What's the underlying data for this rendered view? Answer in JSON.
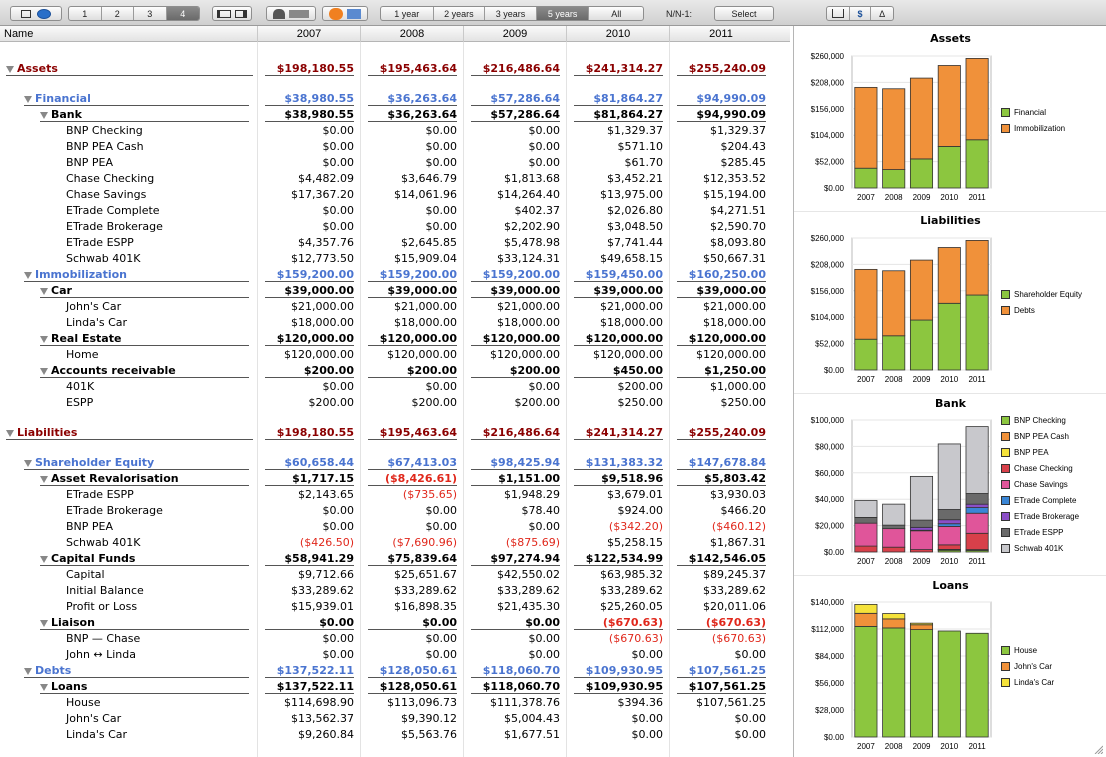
{
  "toolbar": {
    "levels": [
      "1",
      "2",
      "3",
      "4"
    ],
    "selected_level": "4",
    "periods": [
      "1 year",
      "2 years",
      "3 years",
      "5 years",
      "All"
    ],
    "selected_period": "5 years",
    "nn_label": "N/N-1:",
    "select_label": "Select",
    "currency_symbol": "$",
    "delta_symbol": "Δ"
  },
  "table": {
    "name_header": "Name",
    "years": [
      "2007",
      "2008",
      "2009",
      "2010",
      "2011"
    ],
    "rows": [
      {
        "name": "Assets",
        "level": 0,
        "kind": "red",
        "tri": true,
        "v": [
          "$198,180.55",
          "$195,463.64",
          "$216,486.64",
          "$241,314.27",
          "$255,240.09"
        ]
      },
      {
        "name": "",
        "level": 0,
        "kind": "blank",
        "v": [
          "",
          "",
          "",
          "",
          ""
        ]
      },
      {
        "name": "Financial",
        "level": 1,
        "kind": "blue",
        "tri": true,
        "v": [
          "$38,980.55",
          "$36,263.64",
          "$57,286.64",
          "$81,864.27",
          "$94,990.09"
        ]
      },
      {
        "name": "Bank",
        "level": 2,
        "kind": "bold",
        "tri": true,
        "v": [
          "$38,980.55",
          "$36,263.64",
          "$57,286.64",
          "$81,864.27",
          "$94,990.09"
        ]
      },
      {
        "name": "BNP Checking",
        "level": 3,
        "kind": "plain",
        "v": [
          "$0.00",
          "$0.00",
          "$0.00",
          "$1,329.37",
          "$1,329.37"
        ]
      },
      {
        "name": "BNP PEA Cash",
        "level": 3,
        "kind": "plain",
        "v": [
          "$0.00",
          "$0.00",
          "$0.00",
          "$571.10",
          "$204.43"
        ]
      },
      {
        "name": "BNP PEA",
        "level": 3,
        "kind": "plain",
        "v": [
          "$0.00",
          "$0.00",
          "$0.00",
          "$61.70",
          "$285.45"
        ]
      },
      {
        "name": "Chase Checking",
        "level": 3,
        "kind": "plain",
        "v": [
          "$4,482.09",
          "$3,646.79",
          "$1,813.68",
          "$3,452.21",
          "$12,353.52"
        ]
      },
      {
        "name": "Chase Savings",
        "level": 3,
        "kind": "plain",
        "v": [
          "$17,367.20",
          "$14,061.96",
          "$14,264.40",
          "$13,975.00",
          "$15,194.00"
        ]
      },
      {
        "name": "ETrade Complete",
        "level": 3,
        "kind": "plain",
        "v": [
          "$0.00",
          "$0.00",
          "$402.37",
          "$2,026.80",
          "$4,271.51"
        ]
      },
      {
        "name": "ETrade Brokerage",
        "level": 3,
        "kind": "plain",
        "v": [
          "$0.00",
          "$0.00",
          "$2,202.90",
          "$3,048.50",
          "$2,590.70"
        ]
      },
      {
        "name": "ETrade ESPP",
        "level": 3,
        "kind": "plain",
        "v": [
          "$4,357.76",
          "$2,645.85",
          "$5,478.98",
          "$7,741.44",
          "$8,093.80"
        ]
      },
      {
        "name": "Schwab 401K",
        "level": 3,
        "kind": "plain",
        "v": [
          "$12,773.50",
          "$15,909.04",
          "$33,124.31",
          "$49,658.15",
          "$50,667.31"
        ]
      },
      {
        "name": "Immobilization",
        "level": 1,
        "kind": "blue",
        "tri": true,
        "v": [
          "$159,200.00",
          "$159,200.00",
          "$159,200.00",
          "$159,450.00",
          "$160,250.00"
        ]
      },
      {
        "name": "Car",
        "level": 2,
        "kind": "bold",
        "tri": true,
        "v": [
          "$39,000.00",
          "$39,000.00",
          "$39,000.00",
          "$39,000.00",
          "$39,000.00"
        ]
      },
      {
        "name": "John's Car",
        "level": 3,
        "kind": "plain",
        "v": [
          "$21,000.00",
          "$21,000.00",
          "$21,000.00",
          "$21,000.00",
          "$21,000.00"
        ]
      },
      {
        "name": "Linda's Car",
        "level": 3,
        "kind": "plain",
        "v": [
          "$18,000.00",
          "$18,000.00",
          "$18,000.00",
          "$18,000.00",
          "$18,000.00"
        ]
      },
      {
        "name": "Real Estate",
        "level": 2,
        "kind": "bold",
        "tri": true,
        "v": [
          "$120,000.00",
          "$120,000.00",
          "$120,000.00",
          "$120,000.00",
          "$120,000.00"
        ]
      },
      {
        "name": "Home",
        "level": 3,
        "kind": "plain",
        "v": [
          "$120,000.00",
          "$120,000.00",
          "$120,000.00",
          "$120,000.00",
          "$120,000.00"
        ]
      },
      {
        "name": "Accounts receivable",
        "level": 2,
        "kind": "bold",
        "tri": true,
        "v": [
          "$200.00",
          "$200.00",
          "$200.00",
          "$450.00",
          "$1,250.00"
        ]
      },
      {
        "name": "401K",
        "level": 3,
        "kind": "plain",
        "v": [
          "$0.00",
          "$0.00",
          "$0.00",
          "$200.00",
          "$1,000.00"
        ]
      },
      {
        "name": "ESPP",
        "level": 3,
        "kind": "plain",
        "v": [
          "$200.00",
          "$200.00",
          "$200.00",
          "$250.00",
          "$250.00"
        ]
      },
      {
        "name": "",
        "level": 0,
        "kind": "blank",
        "v": [
          "",
          "",
          "",
          "",
          ""
        ]
      },
      {
        "name": "Liabilities",
        "level": 0,
        "kind": "red",
        "tri": true,
        "v": [
          "$198,180.55",
          "$195,463.64",
          "$216,486.64",
          "$241,314.27",
          "$255,240.09"
        ]
      },
      {
        "name": "",
        "level": 0,
        "kind": "blank",
        "v": [
          "",
          "",
          "",
          "",
          ""
        ]
      },
      {
        "name": "Shareholder Equity",
        "level": 1,
        "kind": "blue",
        "tri": true,
        "v": [
          "$60,658.44",
          "$67,413.03",
          "$98,425.94",
          "$131,383.32",
          "$147,678.84"
        ]
      },
      {
        "name": "Asset Revalorisation",
        "level": 2,
        "kind": "bold",
        "tri": true,
        "v": [
          "$1,717.15",
          "($8,426.61)",
          "$1,151.00",
          "$9,518.96",
          "$5,803.42"
        ]
      },
      {
        "name": "ETrade ESPP",
        "level": 3,
        "kind": "plain",
        "v": [
          "$2,143.65",
          "($735.65)",
          "$1,948.29",
          "$3,679.01",
          "$3,930.03"
        ]
      },
      {
        "name": "ETrade Brokerage",
        "level": 3,
        "kind": "plain",
        "v": [
          "$0.00",
          "$0.00",
          "$78.40",
          "$924.00",
          "$466.20"
        ]
      },
      {
        "name": "BNP PEA",
        "level": 3,
        "kind": "plain",
        "v": [
          "$0.00",
          "$0.00",
          "$0.00",
          "($342.20)",
          "($460.12)"
        ]
      },
      {
        "name": "Schwab 401K",
        "level": 3,
        "kind": "plain",
        "v": [
          "($426.50)",
          "($7,690.96)",
          "($875.69)",
          "$5,258.15",
          "$1,867.31"
        ]
      },
      {
        "name": "Capital Funds",
        "level": 2,
        "kind": "bold",
        "tri": true,
        "v": [
          "$58,941.29",
          "$75,839.64",
          "$97,274.94",
          "$122,534.99",
          "$142,546.05"
        ]
      },
      {
        "name": "Capital",
        "level": 3,
        "kind": "plain",
        "v": [
          "$9,712.66",
          "$25,651.67",
          "$42,550.02",
          "$63,985.32",
          "$89,245.37"
        ]
      },
      {
        "name": "Initial Balance",
        "level": 3,
        "kind": "plain",
        "v": [
          "$33,289.62",
          "$33,289.62",
          "$33,289.62",
          "$33,289.62",
          "$33,289.62"
        ]
      },
      {
        "name": "Profit or Loss",
        "level": 3,
        "kind": "plain",
        "v": [
          "$15,939.01",
          "$16,898.35",
          "$21,435.30",
          "$25,260.05",
          "$20,011.06"
        ]
      },
      {
        "name": "Liaison",
        "level": 2,
        "kind": "bold",
        "tri": true,
        "v": [
          "$0.00",
          "$0.00",
          "$0.00",
          "($670.63)",
          "($670.63)"
        ]
      },
      {
        "name": "BNP — Chase",
        "level": 3,
        "kind": "plain",
        "v": [
          "$0.00",
          "$0.00",
          "$0.00",
          "($670.63)",
          "($670.63)"
        ]
      },
      {
        "name": "John ↔ Linda",
        "level": 3,
        "kind": "plain",
        "v": [
          "$0.00",
          "$0.00",
          "$0.00",
          "$0.00",
          "$0.00"
        ]
      },
      {
        "name": "Debts",
        "level": 1,
        "kind": "blue",
        "tri": true,
        "v": [
          "$137,522.11",
          "$128,050.61",
          "$118,060.70",
          "$109,930.95",
          "$107,561.25"
        ]
      },
      {
        "name": "Loans",
        "level": 2,
        "kind": "bold",
        "tri": true,
        "v": [
          "$137,522.11",
          "$128,050.61",
          "$118,060.70",
          "$109,930.95",
          "$107,561.25"
        ]
      },
      {
        "name": "House",
        "level": 3,
        "kind": "plain",
        "v": [
          "$114,698.90",
          "$113,096.73",
          "$111,378.76",
          "$394.36",
          "$107,561.25"
        ]
      },
      {
        "name": "John's Car",
        "level": 3,
        "kind": "plain",
        "v": [
          "$13,562.37",
          "$9,390.12",
          "$5,004.43",
          "$0.00",
          "$0.00"
        ]
      },
      {
        "name": "Linda's Car",
        "level": 3,
        "kind": "plain",
        "v": [
          "$9,260.84",
          "$5,563.76",
          "$1,677.51",
          "$0.00",
          "$0.00"
        ]
      }
    ]
  },
  "chart_data": [
    {
      "type": "bar",
      "title": "Assets",
      "categories": [
        "2007",
        "2008",
        "2009",
        "2010",
        "2011"
      ],
      "stacked": true,
      "ylim": [
        0,
        260000
      ],
      "yticks": [
        "$260,000",
        "$208,000",
        "$156,000",
        "$104,000",
        "$52,000",
        "$0.00"
      ],
      "series": [
        {
          "name": "Financial",
          "color": "#8cc63f",
          "values": [
            38980.55,
            36263.64,
            57286.64,
            81864.27,
            94990.09
          ]
        },
        {
          "name": "Immobilization",
          "color": "#f0913a",
          "values": [
            159200,
            159200,
            159200,
            159450,
            160250
          ]
        }
      ]
    },
    {
      "type": "bar",
      "title": "Liabilities",
      "categories": [
        "2007",
        "2008",
        "2009",
        "2010",
        "2011"
      ],
      "stacked": true,
      "ylim": [
        0,
        260000
      ],
      "yticks": [
        "$260,000",
        "$208,000",
        "$156,000",
        "$104,000",
        "$52,000",
        "$0.00"
      ],
      "series": [
        {
          "name": "Shareholder Equity",
          "color": "#8cc63f",
          "values": [
            60658.44,
            67413.03,
            98425.94,
            131383.32,
            147678.84
          ]
        },
        {
          "name": "Debts",
          "color": "#f0913a",
          "values": [
            137522.11,
            128050.61,
            118060.7,
            109930.95,
            107561.25
          ]
        }
      ]
    },
    {
      "type": "bar",
      "title": "Bank",
      "categories": [
        "2007",
        "2008",
        "2009",
        "2010",
        "2011"
      ],
      "stacked": true,
      "ylim": [
        0,
        100000
      ],
      "yticks": [
        "$100,000",
        "$80,000",
        "$60,000",
        "$40,000",
        "$20,000",
        "$0.00"
      ],
      "series": [
        {
          "name": "BNP Checking",
          "color": "#8cc63f",
          "values": [
            0,
            0,
            0,
            1329.37,
            1329.37
          ]
        },
        {
          "name": "BNP PEA Cash",
          "color": "#f0913a",
          "values": [
            0,
            0,
            0,
            571.1,
            204.43
          ]
        },
        {
          "name": "BNP PEA",
          "color": "#f5e23a",
          "values": [
            0,
            0,
            0,
            61.7,
            285.45
          ]
        },
        {
          "name": "Chase Checking",
          "color": "#d8404a",
          "values": [
            4482.09,
            3646.79,
            1813.68,
            3452.21,
            12353.52
          ]
        },
        {
          "name": "Chase Savings",
          "color": "#e0559a",
          "values": [
            17367.2,
            14061.96,
            14264.4,
            13975.0,
            15194.0
          ]
        },
        {
          "name": "ETrade Complete",
          "color": "#3a86d6",
          "values": [
            0,
            0,
            402.37,
            2026.8,
            4271.51
          ]
        },
        {
          "name": "ETrade Brokerage",
          "color": "#8b4fc8",
          "values": [
            0,
            0,
            2202.9,
            3048.5,
            2590.7
          ]
        },
        {
          "name": "ETrade ESPP",
          "color": "#6a6a6a",
          "values": [
            4357.76,
            2645.85,
            5478.98,
            7741.44,
            8093.8
          ]
        },
        {
          "name": "Schwab 401K",
          "color": "#c8c8cc",
          "values": [
            12773.5,
            15909.04,
            33124.31,
            49658.15,
            50667.31
          ]
        }
      ]
    },
    {
      "type": "bar",
      "title": "Loans",
      "categories": [
        "2007",
        "2008",
        "2009",
        "2010",
        "2011"
      ],
      "stacked": true,
      "ylim": [
        0,
        140000
      ],
      "yticks": [
        "$140,000",
        "$112,000",
        "$84,000",
        "$56,000",
        "$28,000",
        "$0.00"
      ],
      "series": [
        {
          "name": "House",
          "color": "#8cc63f",
          "values": [
            114698.9,
            113096.73,
            111378.76,
            109930.95,
            107561.25
          ]
        },
        {
          "name": "John's Car",
          "color": "#f0913a",
          "values": [
            13562.37,
            9390.12,
            5004.43,
            0,
            0
          ]
        },
        {
          "name": "Linda's Car",
          "color": "#f5e23a",
          "values": [
            9260.84,
            5563.76,
            1677.51,
            0,
            0
          ]
        }
      ]
    }
  ]
}
